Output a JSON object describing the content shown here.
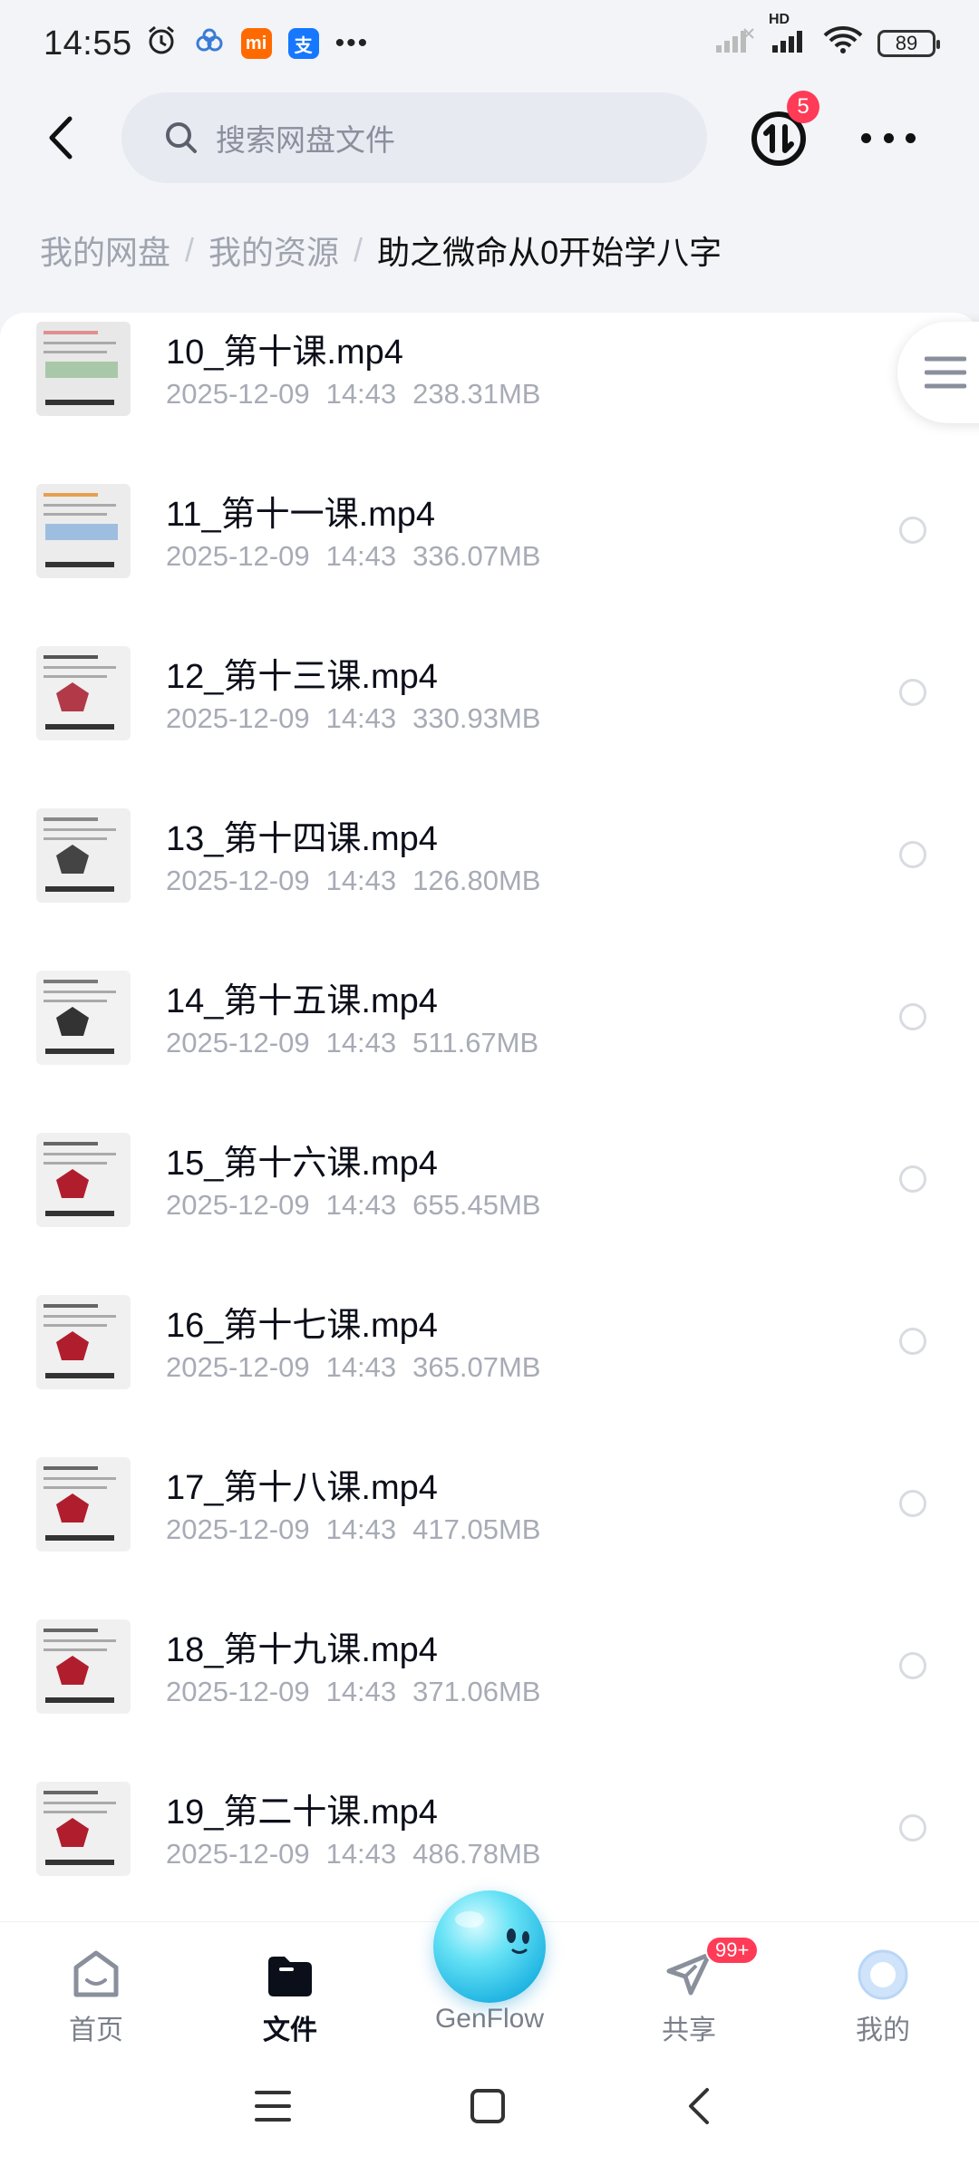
{
  "status_bar": {
    "time": "14:55",
    "battery": "89",
    "network_label": "HD",
    "mini_apps": [
      {
        "label": "mi",
        "color": "#ff6a00"
      },
      {
        "label": "支",
        "color": "#1677ff"
      }
    ]
  },
  "header": {
    "search_placeholder": "搜索网盘文件",
    "transfer_badge": "5"
  },
  "breadcrumb": {
    "items": [
      "我的网盘",
      "我的资源"
    ],
    "separator": "/",
    "current": "助之微命从0开始学八字"
  },
  "files": [
    {
      "name": "10_第十课.mp4",
      "date": "2025-12-09",
      "time": "14:43",
      "size": "238.31MB"
    },
    {
      "name": "11_第十一课.mp4",
      "date": "2025-12-09",
      "time": "14:43",
      "size": "336.07MB"
    },
    {
      "name": "12_第十三课.mp4",
      "date": "2025-12-09",
      "time": "14:43",
      "size": "330.93MB"
    },
    {
      "name": "13_第十四课.mp4",
      "date": "2025-12-09",
      "time": "14:43",
      "size": "126.80MB"
    },
    {
      "name": "14_第十五课.mp4",
      "date": "2025-12-09",
      "time": "14:43",
      "size": "511.67MB"
    },
    {
      "name": "15_第十六课.mp4",
      "date": "2025-12-09",
      "time": "14:43",
      "size": "655.45MB"
    },
    {
      "name": "16_第十七课.mp4",
      "date": "2025-12-09",
      "time": "14:43",
      "size": "365.07MB"
    },
    {
      "name": "17_第十八课.mp4",
      "date": "2025-12-09",
      "time": "14:43",
      "size": "417.05MB"
    },
    {
      "name": "18_第十九课.mp4",
      "date": "2025-12-09",
      "time": "14:43",
      "size": "371.06MB"
    },
    {
      "name": "19_第二十课.mp4",
      "date": "2025-12-09",
      "time": "14:43",
      "size": "486.78MB"
    }
  ],
  "bottom_nav": {
    "items": [
      {
        "label": "首页",
        "icon": "home-icon"
      },
      {
        "label": "文件",
        "icon": "folder-icon"
      },
      {
        "label": "GenFlow",
        "icon": "genflow-orb-icon"
      },
      {
        "label": "共享",
        "icon": "share-plane-icon"
      },
      {
        "label": "我的",
        "icon": "profile-icon"
      }
    ],
    "share_badge": "99+"
  },
  "colors": {
    "accent": "#1ec0e8",
    "badge": "#ff3b57",
    "text_primary": "#0c0f1a",
    "text_secondary": "#a7abb5"
  }
}
